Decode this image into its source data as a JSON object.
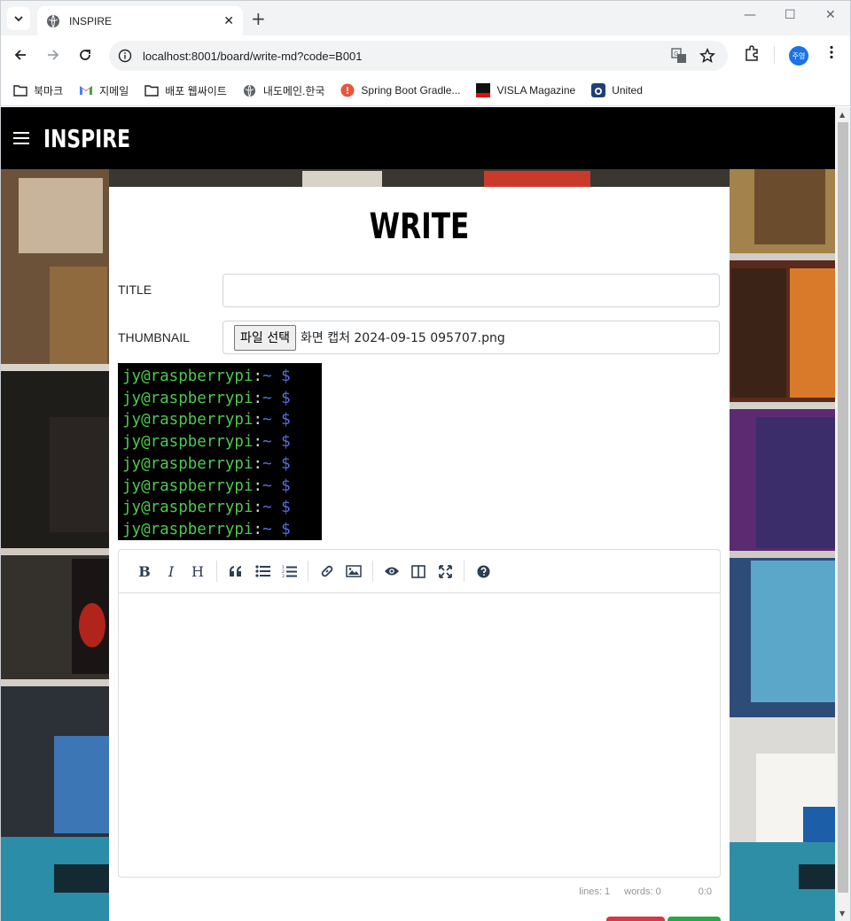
{
  "browser": {
    "tab_title": "INSPIRE",
    "url": "localhost:8001/board/write-md?code=B001",
    "profile_label": "주영",
    "bookmarks": [
      {
        "label": "북마크",
        "icon": "folder-icon"
      },
      {
        "label": "지메일",
        "icon": "gmail-icon"
      },
      {
        "label": "배포 웹싸이트",
        "icon": "folder-icon"
      },
      {
        "label": "내도메인.한국",
        "icon": "globe-icon"
      },
      {
        "label": "Spring Boot Gradle...",
        "icon": "spring-icon"
      },
      {
        "label": "VISLA Magazine",
        "icon": "visla-icon"
      },
      {
        "label": "United",
        "icon": "united-icon"
      }
    ]
  },
  "site": {
    "logo": "INSPIRE"
  },
  "form": {
    "page_title": "WRITE",
    "title_label": "TITLE",
    "title_value": "",
    "thumbnail_label": "THUMBNAIL",
    "file_button": "파일 선택",
    "file_name": "화면 캡처 2024-09-15 095707.png"
  },
  "preview": {
    "lines": [
      {
        "user": "jy@raspberrypi",
        "sep": ":",
        "path": "~",
        "prompt": "$"
      },
      {
        "user": "jy@raspberrypi",
        "sep": ":",
        "path": "~",
        "prompt": "$"
      },
      {
        "user": "jy@raspberrypi",
        "sep": ":",
        "path": "~",
        "prompt": "$"
      },
      {
        "user": "jy@raspberrypi",
        "sep": ":",
        "path": "~",
        "prompt": "$"
      },
      {
        "user": "jy@raspberrypi",
        "sep": ":",
        "path": "~",
        "prompt": "$"
      },
      {
        "user": "jy@raspberrypi",
        "sep": ":",
        "path": "~",
        "prompt": "$"
      },
      {
        "user": "jy@raspberrypi",
        "sep": ":",
        "path": "~",
        "prompt": "$"
      },
      {
        "user": "jy@raspberrypi",
        "sep": ":",
        "path": "~",
        "prompt": "$"
      }
    ]
  },
  "editor": {
    "toolbar": {
      "bold": "B",
      "italic": "I",
      "heading": "H"
    },
    "status": {
      "lines": "lines: 1",
      "words": "words: 0",
      "cursor": "0:0"
    }
  },
  "colors": {
    "header_bg": "#000000",
    "card_bg": "#ffffff",
    "terminal_green": "#4ec94e",
    "terminal_blue": "#5b6ce0",
    "cancel_red": "#dc3545",
    "submit_green": "#28a745"
  }
}
